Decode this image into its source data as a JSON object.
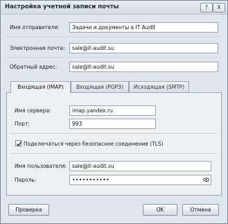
{
  "window": {
    "title": "Настройка учетной записи почты",
    "help_label": "?",
    "close_label": "X"
  },
  "account": {
    "sender_name_label": "Имя отправителя:",
    "sender_name_value": "Задачи и документы в IT Audit",
    "email_label": "Электронная почта:",
    "email_value": "sale@it-audit.su",
    "reply_label": "Обратный адрес:",
    "reply_value": "sale@it-audit.su"
  },
  "tabs": [
    {
      "label": "Входящая (IMAP)",
      "active": true
    },
    {
      "label": "Входящая (POP3)",
      "active": false
    },
    {
      "label": "Исходящая (SMTP)",
      "active": false
    }
  ],
  "imap": {
    "server_label": "Имя сервера:",
    "server_value": "imap.yandex.ru",
    "port_label": "Порт:",
    "port_value": "993",
    "tls_checked": true,
    "tls_label": "Подключаться через безопасное соединение (TLS)",
    "user_label": "Имя пользователя:",
    "user_value": "sale@it-audit.su",
    "password_label": "Пароль:",
    "password_value": "•••••••••••",
    "eye_icon": "eye-icon"
  },
  "buttons": {
    "check_label": "Проверка",
    "ok_label": "OK",
    "cancel_label": "Отмена"
  }
}
